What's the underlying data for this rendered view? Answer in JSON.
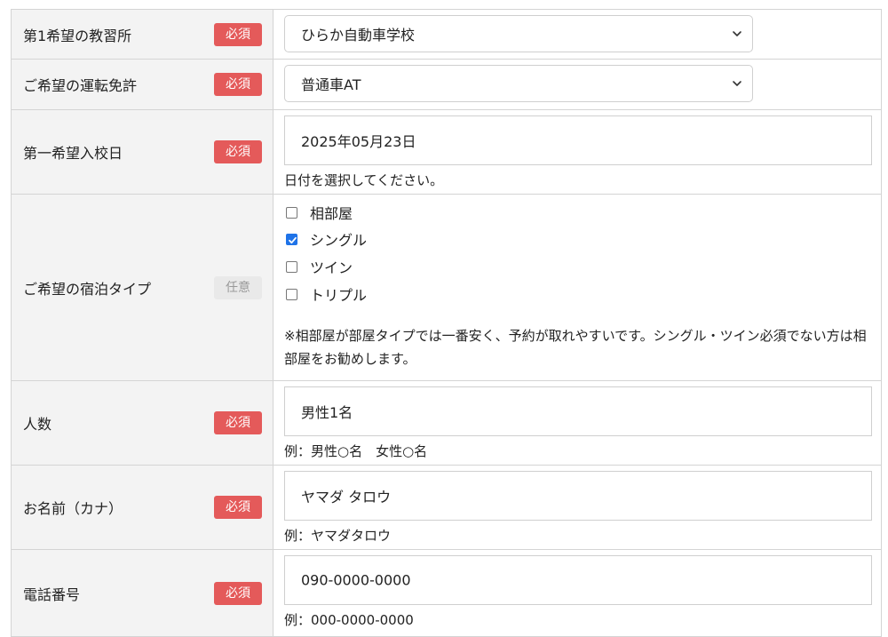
{
  "badges": {
    "required": "必須",
    "optional": "任意"
  },
  "rows": {
    "school": {
      "label": "第1希望の教習所",
      "value": "ひらか自動車学校"
    },
    "license": {
      "label": "ご希望の運転免許",
      "value": "普通車AT"
    },
    "date": {
      "label": "第一希望入校日",
      "value": "2025年05月23日",
      "help": "日付を選択してください。"
    },
    "room": {
      "label": "ご希望の宿泊タイプ",
      "options": [
        {
          "label": "相部屋",
          "checked": false
        },
        {
          "label": "シングル",
          "checked": true
        },
        {
          "label": "ツイン",
          "checked": false
        },
        {
          "label": "トリプル",
          "checked": false
        }
      ],
      "note": "※相部屋が部屋タイプでは一番安く、予約が取れやすいです。シングル・ツイン必須でない方は相部屋をお勧めします。"
    },
    "people": {
      "label": "人数",
      "value": "男性1名",
      "help": "例：男性○名　女性○名"
    },
    "name_kana": {
      "label": "お名前（カナ）",
      "value": "ヤマダ タロウ",
      "help": "例：ヤマダタロウ"
    },
    "phone": {
      "label": "電話番号",
      "value": "090-0000-0000",
      "help": "例：000-0000-0000"
    }
  },
  "colors": {
    "required_badge": "#e45a5a",
    "optional_badge": "#e9e9e9",
    "label_bg": "#f3f3f3",
    "border": "#d4d4d4",
    "check_blue": "#1f73e8"
  }
}
